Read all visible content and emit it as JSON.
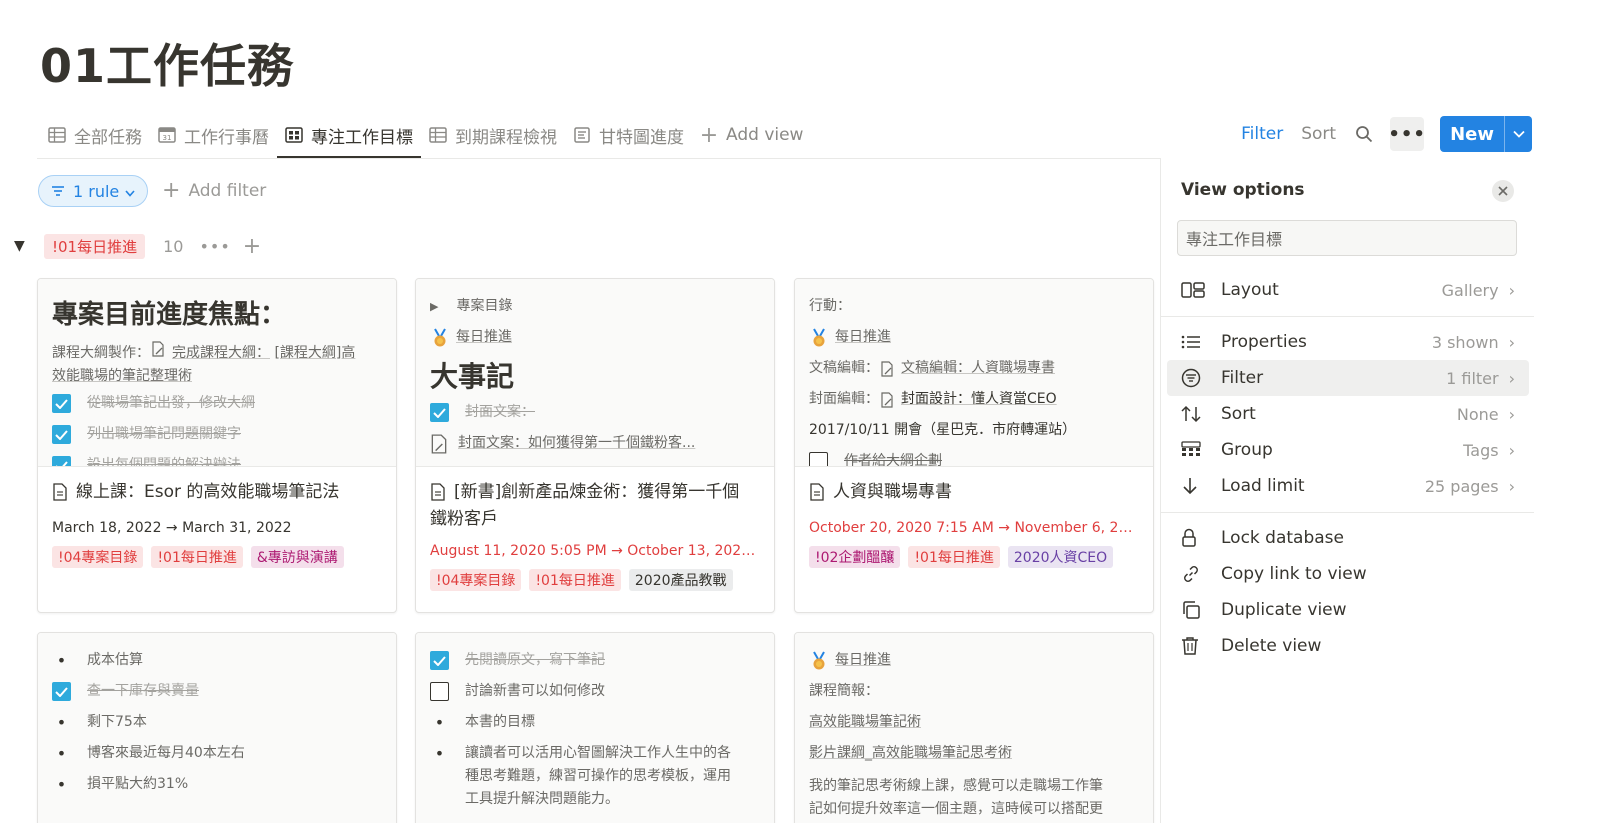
{
  "page": {
    "title": "01工作任務"
  },
  "tabs": [
    {
      "label": "全部任務",
      "icon": "table-icon"
    },
    {
      "label": "工作行事曆",
      "icon": "calendar-icon"
    },
    {
      "label": "專注工作目標",
      "icon": "gallery-icon",
      "active": true
    },
    {
      "label": "到期課程檢視",
      "icon": "table-icon"
    },
    {
      "label": "甘特圖進度",
      "icon": "timeline-icon"
    }
  ],
  "add_view": "Add view",
  "toolbar": {
    "filter": "Filter",
    "sort": "Sort",
    "new": "New",
    "more": "•••"
  },
  "filter_bar": {
    "rule_chip": "1 rule",
    "add_filter": "Add filter"
  },
  "group": {
    "tag": "!01每日推進",
    "count": "10",
    "more": "•••",
    "add": "+"
  },
  "cards": [
    {
      "preview": {
        "heading": "專案目前進度焦點：",
        "intro_prefix": "課程大綱製作：",
        "intro_link": "完成課程大綱：",
        "intro_rest": "[課程大綱]高",
        "intro_line2": "效能職場的筆記整理術",
        "items": [
          "從職場筆記出發，修改大綱",
          "列出職場筆記問題關鍵字",
          "設出每個問題的解決辦法"
        ]
      },
      "title": "線上課：Esor 的高效能職場筆記法",
      "date": "March 18, 2022 → March 31, 2022",
      "tags": [
        "!04專案目錄",
        "!01每日推進",
        "&專訪與演講"
      ]
    },
    {
      "preview": {
        "toggle": "專案目錄",
        "link": "每日推進",
        "heading": "大事記",
        "item_done": "封面文案：",
        "item_link": "封面文案：如何獲得第一千個鐵粉客..."
      },
      "title_line1": "[新書]創新產品煉金術：獲得第一千個",
      "title_line2": "鐵粉客戶",
      "date": "August 11, 2020 5:05 PM → October 13, 2020 5:0...",
      "tags": [
        "!04專案目錄",
        "!01每日推進",
        "2020產品教戰"
      ]
    },
    {
      "preview": {
        "line1": "行動：",
        "link": "每日推進",
        "line3_prefix": "文稿編輯：",
        "line3_link": "文稿編輯：人資職場專書",
        "line4_prefix": "封面編輯：",
        "line4_link": "封面設計：懂人資當CEO",
        "line5": "2017/10/11 開會（星巴克．市府轉運站）",
        "item": "作者給大綱企劃"
      },
      "title": "人資與職場專書",
      "date": "October 20, 2020 7:15 AM → November 6, 2020 ...",
      "tags": [
        "!02企劃醞釀",
        "!01每日推進",
        "2020人資CEO"
      ]
    },
    {
      "preview": {
        "b1": "成本估算",
        "c1": "查一下庫存與賣量",
        "b2": "剩下75本",
        "b3": "博客來最近每月40本左右",
        "b4": "損平點大約31%"
      }
    },
    {
      "preview": {
        "c1": "先閱讀原文，寫下筆記",
        "c2": "討論新書可以如何修改",
        "b1": "本書的目標",
        "b2_l1": "讓讀者可以活用心智圖解決工作人生中的各",
        "b2_l2": "種思考難題，練習可操作的思考模板，運用",
        "b2_l3": "工具提升解決問題能力。"
      }
    },
    {
      "preview": {
        "link": "每日推進",
        "line2": "課程簡報：",
        "line3": "高效能職場筆記術",
        "line4": "影片課綱_高效能職場筆記思考術",
        "line5": "我的筆記思考術線上課，感覺可以走職場工作筆",
        "line6": "記如何提升效率這一個主題，這時候可以搭配更"
      }
    }
  ],
  "view_options": {
    "title": "View options",
    "name": "專注工作目標",
    "layout": {
      "label": "Layout",
      "value": "Gallery"
    },
    "properties": {
      "label": "Properties",
      "value": "3 shown"
    },
    "filter": {
      "label": "Filter",
      "value": "1 filter"
    },
    "sort": {
      "label": "Sort",
      "value": "None"
    },
    "group": {
      "label": "Group",
      "value": "Tags"
    },
    "load_limit": {
      "label": "Load limit",
      "value": "25 pages"
    },
    "lock": "Lock database",
    "copy_link": "Copy link to view",
    "duplicate": "Duplicate view",
    "delete": "Delete view"
  },
  "colors": {
    "accent": "#2383e2",
    "checkbox": "#2eaadc",
    "tag_red_bg": "#fbe4e4",
    "tag_red_text": "#e03e3e"
  }
}
